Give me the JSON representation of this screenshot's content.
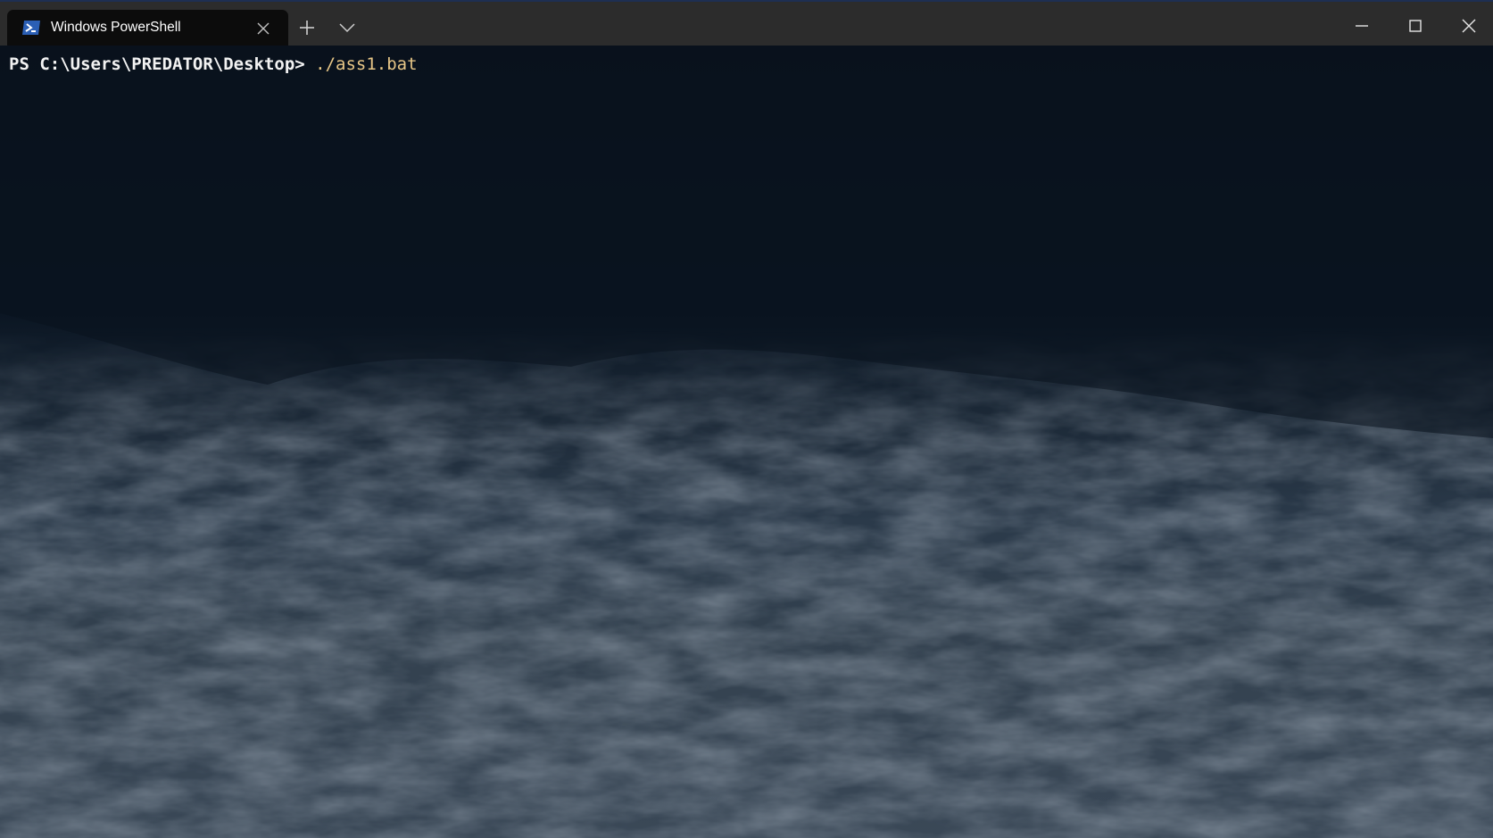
{
  "window": {
    "tab_title": "Windows PowerShell",
    "tab_icon": "powershell-icon",
    "close_tab_icon": "close-icon",
    "new_tab_icon": "plus-icon",
    "dropdown_icon": "chevron-down-icon",
    "minimize_icon": "minimize-icon",
    "maximize_icon": "maximize-icon",
    "close_window_icon": "close-icon"
  },
  "terminal": {
    "prompt": "PS C:\\Users\\PREDATOR\\Desktop> ",
    "command": "./ass1.bat"
  },
  "colors": {
    "titlebar": "#2c2c2c",
    "tab_active": "#0c0c0c",
    "prompt_text": "#f2f2f2",
    "command_text": "#e8c787",
    "powershell_blue": "#2b5fb5"
  }
}
